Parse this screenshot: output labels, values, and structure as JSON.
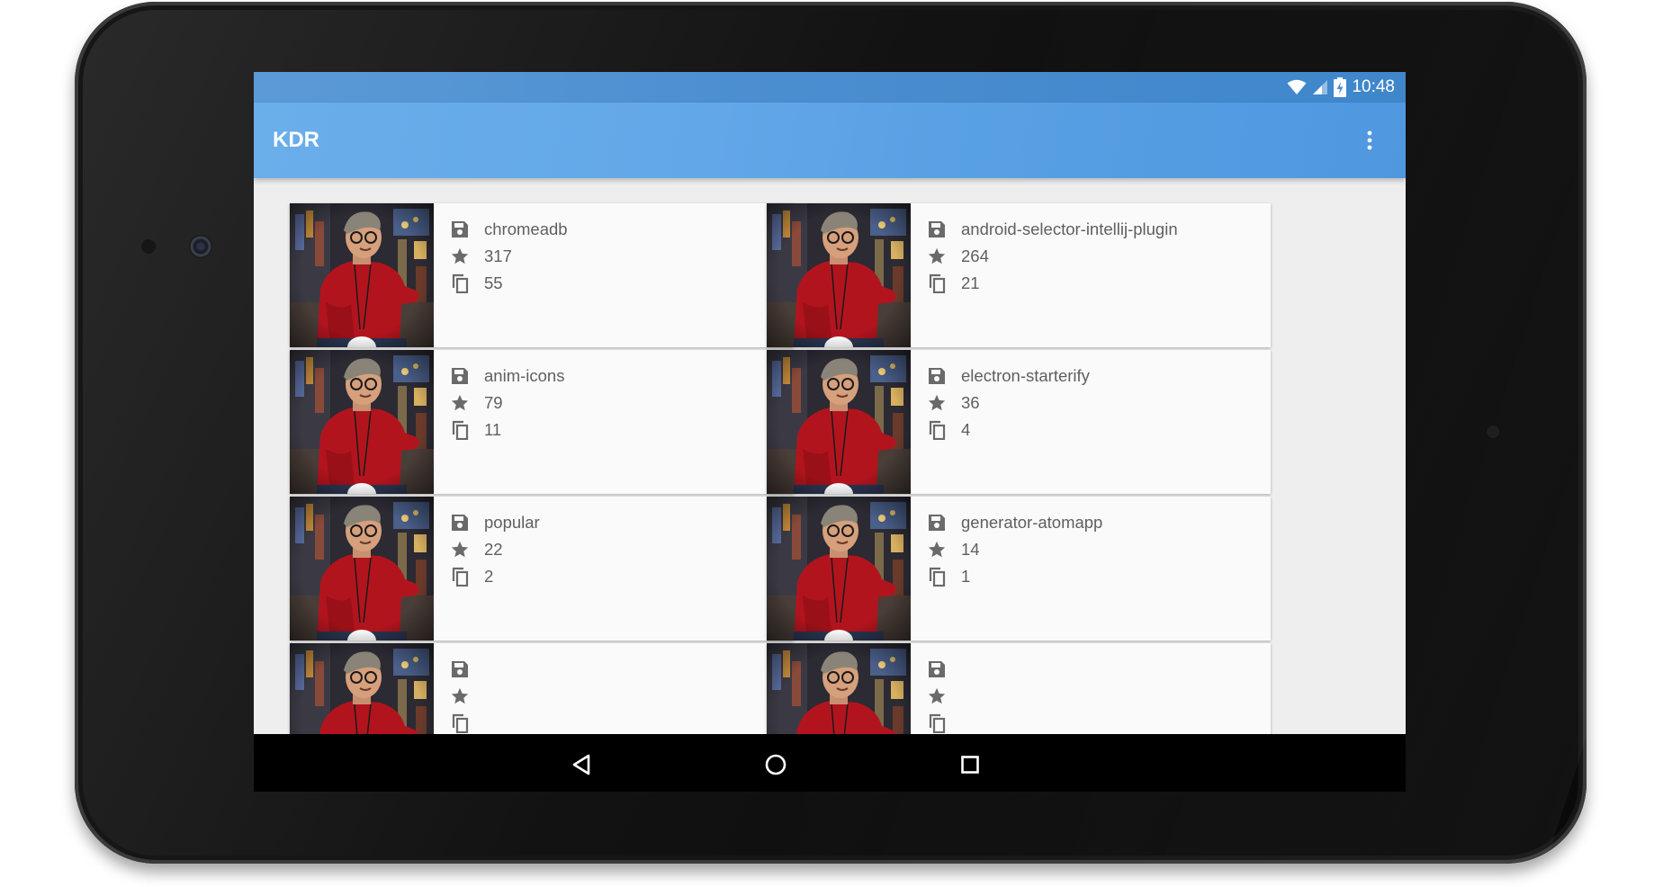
{
  "status_bar": {
    "time": "10:48",
    "icons": [
      "wifi-icon",
      "signal-icon",
      "battery-charging-icon"
    ]
  },
  "app_bar": {
    "title": "KDR",
    "menu_icon": "more-vert-icon"
  },
  "repos": [
    {
      "name": "chromeadb",
      "stars": "317",
      "forks": "55"
    },
    {
      "name": "android-selector-intellij-plugin",
      "stars": "264",
      "forks": "21"
    },
    {
      "name": "anim-icons",
      "stars": "79",
      "forks": "11"
    },
    {
      "name": "electron-starterify",
      "stars": "36",
      "forks": "4"
    },
    {
      "name": "popular",
      "stars": "22",
      "forks": "2"
    },
    {
      "name": "generator-atomapp",
      "stars": "14",
      "forks": "1"
    },
    {
      "name": "",
      "stars": "",
      "forks": ""
    },
    {
      "name": "",
      "stars": "",
      "forks": ""
    }
  ],
  "card_icons": {
    "name": "save-icon",
    "stars": "star-icon",
    "forks": "copy-icon"
  },
  "nav_bar": {
    "icons": [
      "back-icon",
      "home-icon",
      "recents-icon"
    ]
  },
  "colors": {
    "status_bar": "#4b8ed0",
    "app_bar": "#62a7e8",
    "background": "#eeeeee",
    "card": "#fafafa",
    "text_secondary": "#5f5f5f"
  }
}
